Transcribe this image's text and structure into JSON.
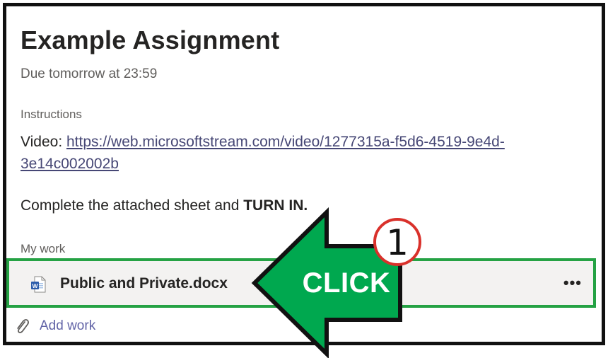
{
  "assignment": {
    "title": "Example Assignment",
    "due": "Due tomorrow at 23:59",
    "instructions_label": "Instructions",
    "video_prefix": "Video: ",
    "video_url": "https://web.microsoftstream.com/video/1277315a-f5d6-4519-9e4d-3e14c002002b",
    "complete_prefix": "Complete the attached sheet and ",
    "complete_bold": "TURN IN."
  },
  "my_work": {
    "label": "My work",
    "file_name": "Public and Private.docx",
    "file_icon": "word-document-icon",
    "more_label": "•••",
    "add_work_label": "Add work",
    "add_work_icon": "paperclip-icon"
  },
  "annotation": {
    "click_label": "CLICK",
    "step_number": "1",
    "arrow_color": "#00a84f",
    "highlight_color": "#25a244",
    "badge_color": "#d9312b"
  }
}
